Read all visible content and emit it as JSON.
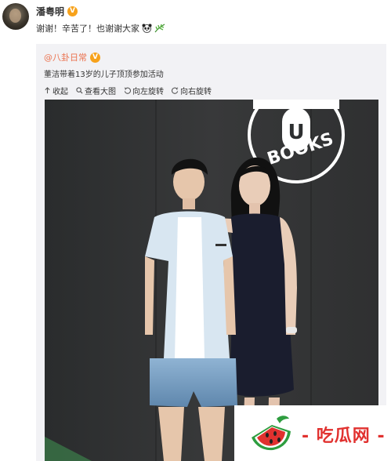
{
  "post": {
    "author": "潘粤明",
    "text": "谢谢！辛苦了！也谢谢大家",
    "emojis": [
      "panda-emoji",
      "leaf-emoji"
    ]
  },
  "repost": {
    "author": "@八卦日常",
    "text": "董洁带着13岁的儿子顶顶参加活动",
    "actions": {
      "collect": "收起",
      "view_large": "查看大图",
      "rotate_left": "向左旋转",
      "rotate_right": "向右旋转"
    }
  },
  "photo": {
    "sign": [
      "U",
      "BOOKS"
    ]
  },
  "watermark": {
    "text": "- 吃瓜网 -"
  },
  "colors": {
    "repost_author": "#eb7350",
    "badge": "#f7a21b",
    "watermark": "#e1312f"
  }
}
